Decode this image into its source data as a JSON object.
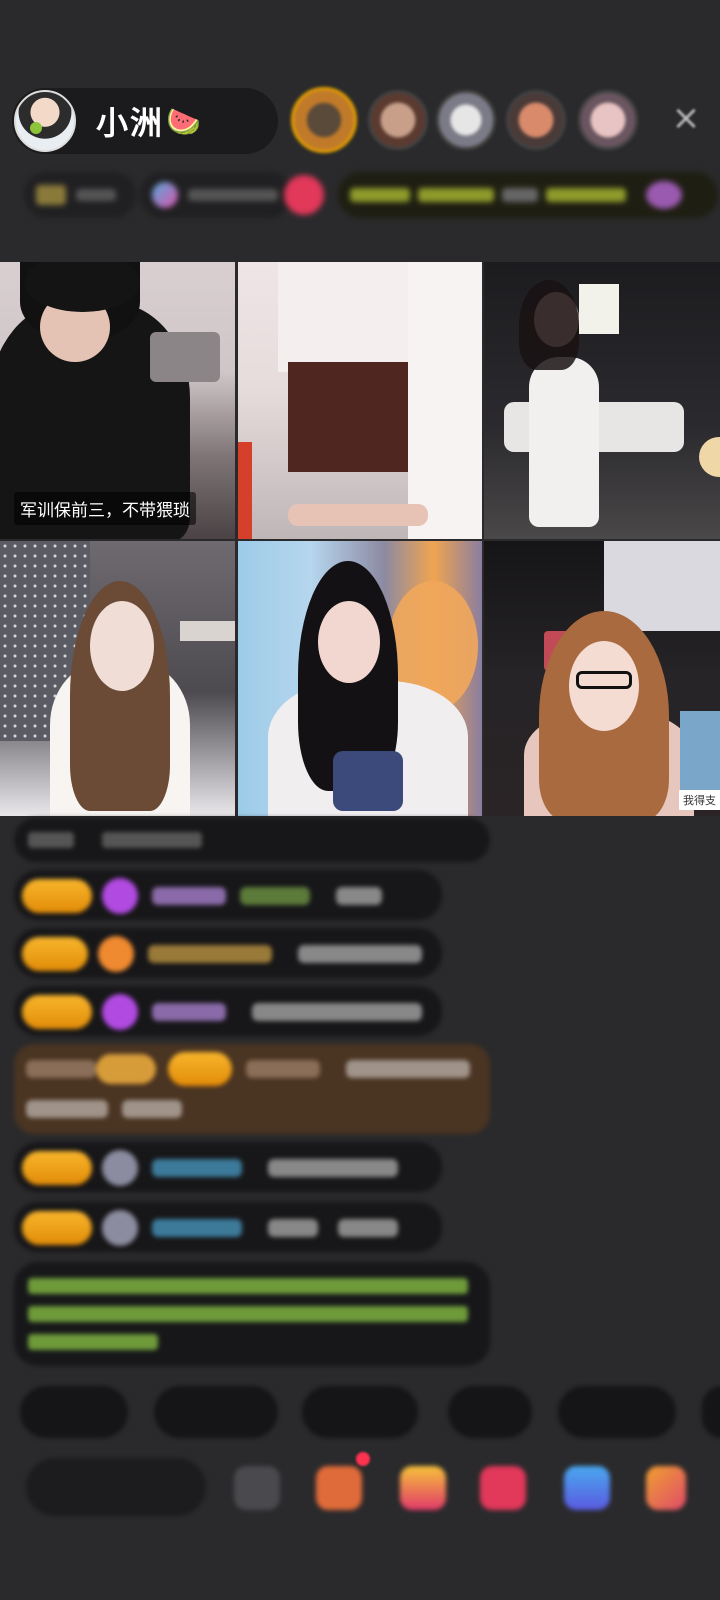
{
  "host": {
    "name": "小洲",
    "emoji": "🍉"
  },
  "close_icon": "×",
  "stream_tiles": [
    {
      "caption": "军训保前三，不带猥琐"
    },
    {
      "caption": ""
    },
    {
      "caption": ""
    },
    {
      "caption": ""
    },
    {
      "caption": ""
    },
    {
      "caption": "我得支"
    }
  ],
  "colors": {
    "background": "#2a2a2c",
    "badge_gold": "#f7b52c",
    "purple_gem": "#b04ae0",
    "chat_green": "#7ab83a"
  }
}
